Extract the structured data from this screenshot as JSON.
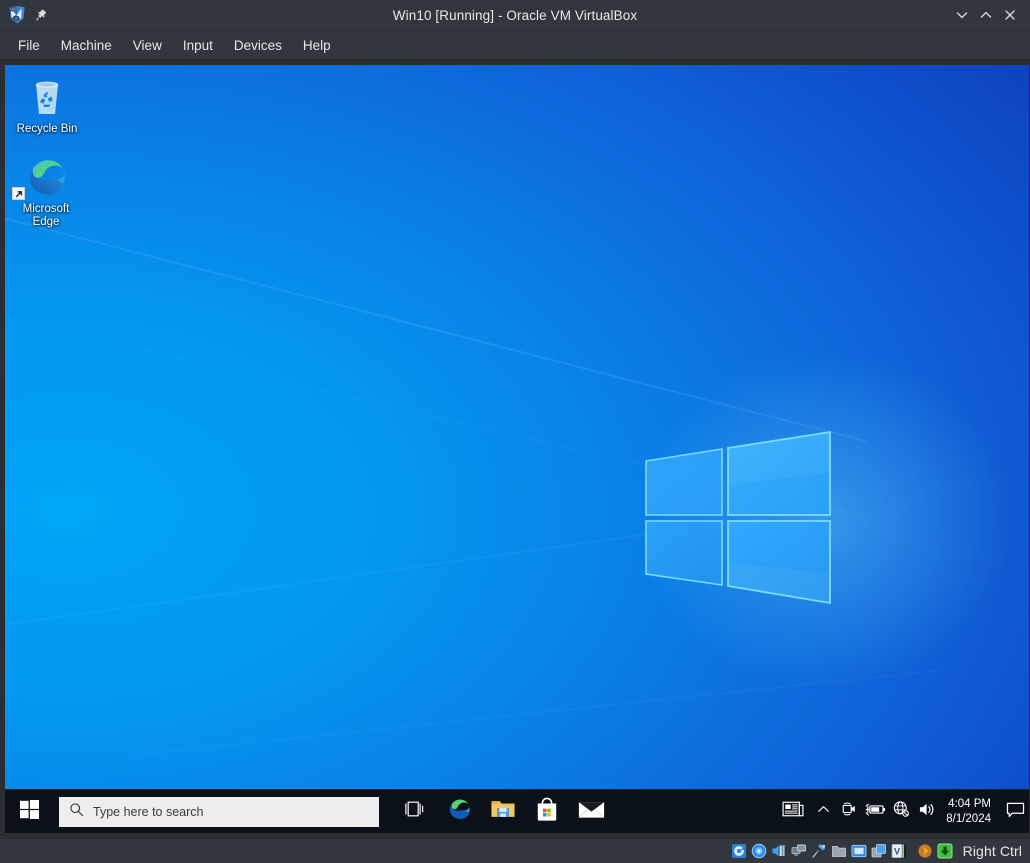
{
  "window": {
    "title": "Win10 [Running] - Oracle VM VirtualBox",
    "app_icon": "virtualbox-icon",
    "pin_icon": "pin-icon",
    "controls": [
      {
        "name": "minimize-button",
        "icon": "chevron-down-icon",
        "label": "⌄"
      },
      {
        "name": "maximize-button",
        "icon": "chevron-up-icon",
        "label": "⌃"
      },
      {
        "name": "close-button",
        "icon": "close-icon",
        "label": "✕"
      }
    ]
  },
  "menubar": {
    "items": [
      {
        "label": "File"
      },
      {
        "label": "Machine"
      },
      {
        "label": "View"
      },
      {
        "label": "Input"
      },
      {
        "label": "Devices"
      },
      {
        "label": "Help"
      }
    ]
  },
  "desktop": {
    "icons": [
      {
        "label": "Recycle Bin",
        "icon": "recycle-bin-icon",
        "shortcut": false
      },
      {
        "label": "Microsoft Edge",
        "icon": "microsoft-edge-icon",
        "shortcut": true
      }
    ],
    "wallpaper": {
      "name": "windows-10-hero-wallpaper",
      "color_left": "#00a6f7",
      "color_right": "#0d40b8"
    }
  },
  "taskbar": {
    "start_button": {
      "name": "start-button",
      "icon": "windows-logo-icon"
    },
    "search": {
      "icon": "search-icon",
      "placeholder": "Type here to search",
      "value": ""
    },
    "task_view": {
      "name": "task-view-button",
      "icon": "task-view-icon"
    },
    "apps": [
      {
        "name": "taskbar-app-edge",
        "icon": "microsoft-edge-icon",
        "label": "Microsoft Edge"
      },
      {
        "name": "taskbar-app-file-explorer",
        "icon": "file-explorer-icon",
        "label": "File Explorer"
      },
      {
        "name": "taskbar-app-microsoft-store",
        "icon": "microsoft-store-icon",
        "label": "Microsoft Store"
      },
      {
        "name": "taskbar-app-mail",
        "icon": "mail-icon",
        "label": "Mail"
      }
    ],
    "tray": [
      {
        "name": "tray-news-and-interests",
        "icon": "news-icon"
      },
      {
        "name": "tray-show-hidden-icons",
        "icon": "chevron-up-icon"
      },
      {
        "name": "tray-meet-now",
        "icon": "camera-icon"
      },
      {
        "name": "tray-battery",
        "icon": "battery-charging-icon"
      },
      {
        "name": "tray-network",
        "icon": "globe-no-internet-icon"
      },
      {
        "name": "tray-volume",
        "icon": "speaker-icon"
      }
    ],
    "clock": {
      "time": "4:04 PM",
      "date": "8/1/2024"
    },
    "notifications": {
      "name": "action-center-button",
      "icon": "speech-bubble-icon"
    }
  },
  "statusbar": {
    "indicators": [
      {
        "name": "status-hard-disks",
        "icon": "hard-disk-icon"
      },
      {
        "name": "status-optical-drives",
        "icon": "optical-disc-icon"
      },
      {
        "name": "status-audio",
        "icon": "audio-icon"
      },
      {
        "name": "status-network",
        "icon": "network-icon"
      },
      {
        "name": "status-usb",
        "icon": "usb-icon"
      },
      {
        "name": "status-shared-folders",
        "icon": "shared-folder-icon"
      },
      {
        "name": "status-display",
        "icon": "display-icon"
      },
      {
        "name": "status-recording",
        "icon": "recording-icon"
      },
      {
        "name": "status-vm-features",
        "icon": "virtualization-icon"
      },
      {
        "name": "status-mouse-integration",
        "icon": "mouse-pointer-icon"
      },
      {
        "name": "status-keyboard",
        "icon": "keyboard-host-icon"
      }
    ],
    "host_key": "Right Ctrl"
  }
}
